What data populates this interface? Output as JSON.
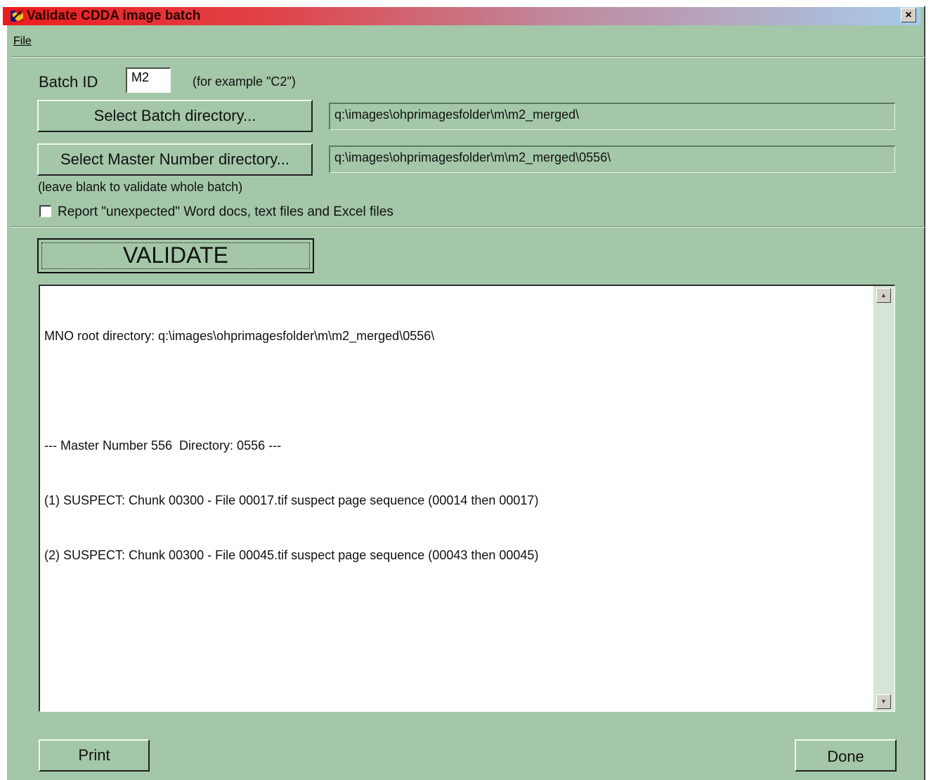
{
  "window": {
    "title": "Validate CDDA image batch",
    "close_label": "×",
    "title_gradient": [
      "#ec1c1c",
      "#a7cbea"
    ],
    "background": "#a3c7a8"
  },
  "menu": {
    "file_label": "File"
  },
  "batch": {
    "label": "Batch ID",
    "value": "M2",
    "hint": "(for example \"C2\")"
  },
  "batch_dir": {
    "button_label": "Select Batch directory...",
    "path": "q:\\images\\ohprimagesfolder\\m\\m2_merged\\"
  },
  "master_dir": {
    "button_label": "Select Master Number directory...",
    "path": "q:\\images\\ohprimagesfolder\\m\\m2_merged\\0556\\",
    "hint": "(leave blank to validate whole batch)"
  },
  "report_checkbox": {
    "label": "Report \"unexpected\" Word docs, text files and Excel files",
    "checked": false
  },
  "validate_label": "VALIDATE",
  "output": {
    "lines": [
      "MNO root directory: q:\\images\\ohprimagesfolder\\m\\m2_merged\\0556\\",
      "",
      "--- Master Number 556  Directory: 0556 ---",
      "(1) SUSPECT: Chunk 00300 - File 00017.tif suspect page sequence (00014 then 00017)",
      "(2) SUSPECT: Chunk 00300 - File 00045.tif suspect page sequence (00043 then 00045)"
    ]
  },
  "footer": {
    "print_label": "Print",
    "done_label": "Done"
  },
  "icons": {
    "app": "app-icon",
    "close": "close-icon",
    "scroll_up": "scroll-up-icon",
    "scroll_down": "scroll-down-icon"
  }
}
